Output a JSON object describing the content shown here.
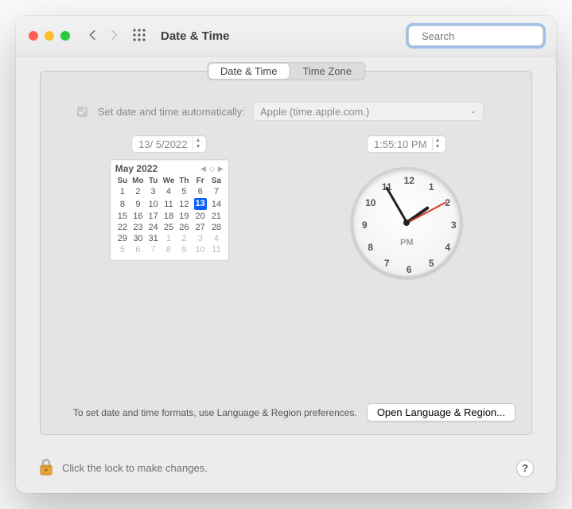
{
  "window": {
    "title": "Date & Time"
  },
  "search": {
    "placeholder": "Search"
  },
  "tabs": {
    "date_time": "Date & Time",
    "time_zone": "Time Zone"
  },
  "auto": {
    "label": "Set date and time automatically:",
    "server": "Apple (time.apple.com.)"
  },
  "date_field": "13/  5/2022",
  "time_field": "1:55:10 PM",
  "calendar": {
    "month": "May 2022",
    "weekdays": [
      "Su",
      "Mo",
      "Tu",
      "We",
      "Th",
      "Fr",
      "Sa"
    ],
    "rows": [
      [
        {
          "n": 1
        },
        {
          "n": 2
        },
        {
          "n": 3
        },
        {
          "n": 4
        },
        {
          "n": 5
        },
        {
          "n": 6
        },
        {
          "n": 7
        }
      ],
      [
        {
          "n": 8
        },
        {
          "n": 9
        },
        {
          "n": 10
        },
        {
          "n": 11
        },
        {
          "n": 12
        },
        {
          "n": 13,
          "sel": true
        },
        {
          "n": 14
        }
      ],
      [
        {
          "n": 15
        },
        {
          "n": 16
        },
        {
          "n": 17
        },
        {
          "n": 18
        },
        {
          "n": 19
        },
        {
          "n": 20
        },
        {
          "n": 21
        }
      ],
      [
        {
          "n": 22
        },
        {
          "n": 23
        },
        {
          "n": 24
        },
        {
          "n": 25
        },
        {
          "n": 26
        },
        {
          "n": 27
        },
        {
          "n": 28
        }
      ],
      [
        {
          "n": 29
        },
        {
          "n": 30
        },
        {
          "n": 31
        },
        {
          "n": 1,
          "muted": true
        },
        {
          "n": 2,
          "muted": true
        },
        {
          "n": 3,
          "muted": true
        },
        {
          "n": 4,
          "muted": true
        }
      ],
      [
        {
          "n": 5,
          "muted": true
        },
        {
          "n": 6,
          "muted": true
        },
        {
          "n": 7,
          "muted": true
        },
        {
          "n": 8,
          "muted": true
        },
        {
          "n": 9,
          "muted": true
        },
        {
          "n": 10,
          "muted": true
        },
        {
          "n": 11,
          "muted": true
        }
      ]
    ]
  },
  "clock": {
    "ampm": "PM"
  },
  "footer": {
    "hint": "To set date and time formats, use Language & Region preferences.",
    "button": "Open Language & Region..."
  },
  "lock": {
    "text": "Click the lock to make changes."
  },
  "help": {
    "label": "?"
  }
}
